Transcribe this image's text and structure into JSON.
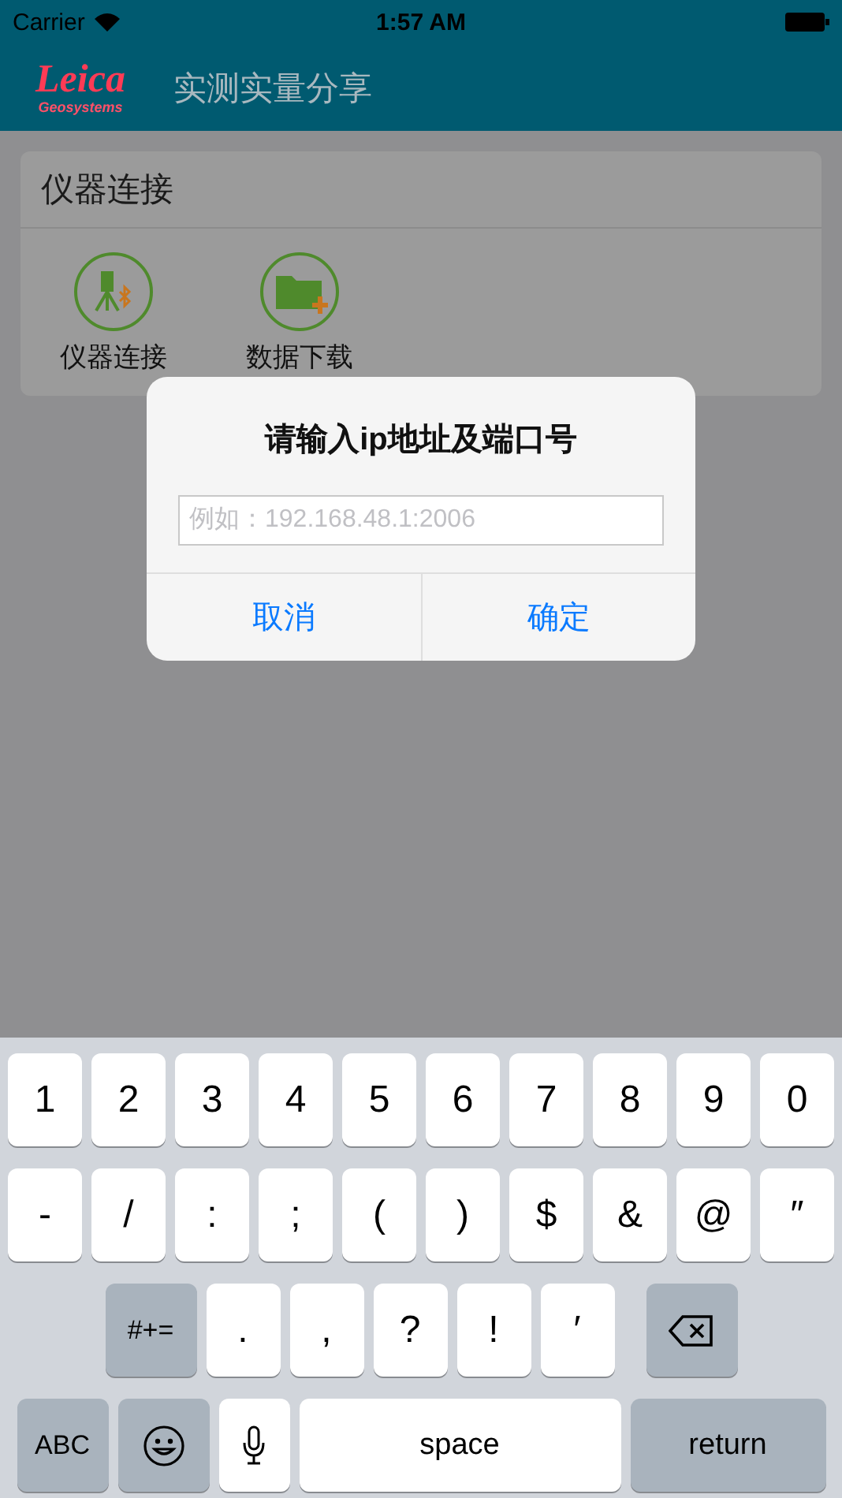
{
  "status_bar": {
    "carrier": "Carrier",
    "time": "1:57 AM"
  },
  "nav_bar": {
    "logo_name": "Leica",
    "logo_sub": "Geosystems",
    "title": "实测实量分享"
  },
  "card": {
    "title": "仪器连接",
    "items": [
      {
        "kind": "instrument",
        "label": "仪器连接"
      },
      {
        "kind": "download",
        "label": "数据下载"
      }
    ]
  },
  "dialog": {
    "title": "请输入ip地址及端口号",
    "placeholder": "例如：192.168.48.1:2006",
    "buttons": [
      {
        "label": "取消",
        "bold": false
      },
      {
        "label": "确定",
        "bold": false
      }
    ]
  },
  "keyboard": {
    "rows": [
      {
        "keys": [
          {
            "kind": "char",
            "label": "1"
          },
          {
            "kind": "char",
            "label": "2"
          },
          {
            "kind": "char",
            "label": "3"
          },
          {
            "kind": "char",
            "label": "4"
          },
          {
            "kind": "char",
            "label": "5"
          },
          {
            "kind": "char",
            "label": "6"
          },
          {
            "kind": "char",
            "label": "7"
          },
          {
            "kind": "char",
            "label": "8"
          },
          {
            "kind": "char",
            "label": "9"
          },
          {
            "kind": "char",
            "label": "0"
          }
        ]
      },
      {
        "keys": [
          {
            "kind": "char",
            "label": "-"
          },
          {
            "kind": "char",
            "label": "/"
          },
          {
            "kind": "char",
            "label": ":"
          },
          {
            "kind": "char",
            "label": ";"
          },
          {
            "kind": "char",
            "label": "("
          },
          {
            "kind": "char",
            "label": ")"
          },
          {
            "kind": "char",
            "label": "$"
          },
          {
            "kind": "char",
            "label": "&"
          },
          {
            "kind": "char",
            "label": "@"
          },
          {
            "kind": "char",
            "label": "″"
          }
        ]
      },
      {
        "keys": [
          {
            "kind": "function",
            "label": "#+="
          },
          {
            "kind": "char",
            "label": "."
          },
          {
            "kind": "char",
            "label": ","
          },
          {
            "kind": "char",
            "label": "?"
          },
          {
            "kind": "char",
            "label": "!"
          },
          {
            "kind": "char",
            "label": "′"
          },
          {
            "kind": "delete"
          }
        ]
      },
      {
        "keys": [
          {
            "kind": "function",
            "label": "ABC"
          },
          {
            "kind": "emoji"
          },
          {
            "kind": "mic"
          },
          {
            "kind": "space",
            "label": "space"
          },
          {
            "kind": "return",
            "label": "return"
          }
        ]
      }
    ]
  }
}
